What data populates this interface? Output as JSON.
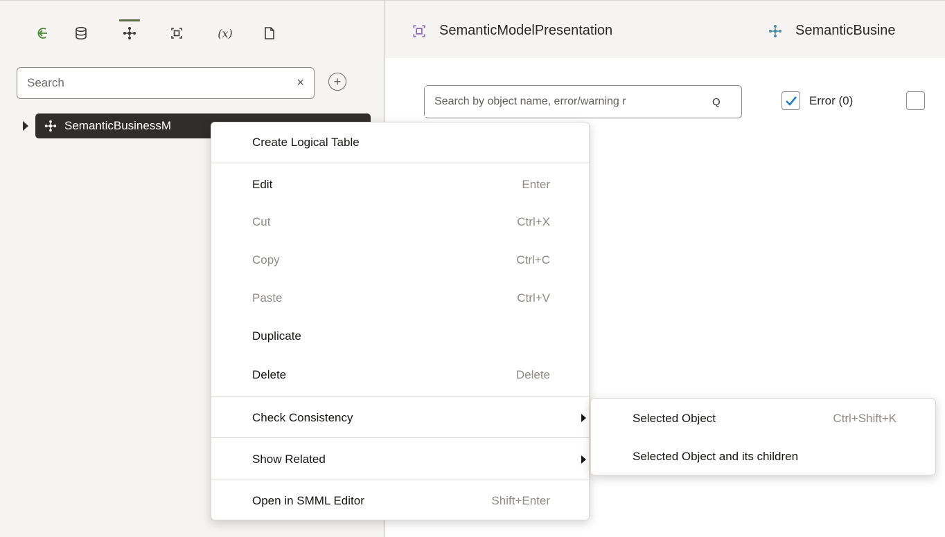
{
  "toolbar": {
    "icons": [
      "back-arrow-icon",
      "database-icon",
      "business-model-icon",
      "presentation-icon",
      "variables-icon",
      "document-icon"
    ],
    "variables_label": "(x)",
    "active_index": 2
  },
  "search": {
    "placeholder": "Search",
    "clear_label": "×",
    "add_label": "+"
  },
  "tree": {
    "node_label": "SemanticBusinessM"
  },
  "tabs": [
    {
      "label": "SemanticModelPresentation",
      "icon": "presentation-icon"
    },
    {
      "label": "SemanticBusine",
      "icon": "business-model-icon"
    }
  ],
  "issues": {
    "search_placeholder": "Search by object name, error/warning r",
    "search_icon": "Q",
    "error_label": "Error (0)",
    "error_checked": true,
    "warning_checked": false
  },
  "context_menu": {
    "items": [
      {
        "label": "Create Logical Table",
        "shortcut": "",
        "disabled": false
      },
      {
        "label": "Edit",
        "shortcut": "Enter",
        "disabled": false
      },
      {
        "label": "Cut",
        "shortcut": "Ctrl+X",
        "disabled": true
      },
      {
        "label": "Copy",
        "shortcut": "Ctrl+C",
        "disabled": true
      },
      {
        "label": "Paste",
        "shortcut": "Ctrl+V",
        "disabled": true
      },
      {
        "label": "Duplicate",
        "shortcut": "",
        "disabled": false
      },
      {
        "label": "Delete",
        "shortcut": "Delete",
        "disabled": false
      },
      {
        "label": "Check Consistency",
        "shortcut": "",
        "disabled": false,
        "submenu": true
      },
      {
        "label": "Show Related",
        "shortcut": "",
        "disabled": false,
        "submenu": true
      },
      {
        "label": "Open in SMML Editor",
        "shortcut": "Shift+Enter",
        "disabled": false
      }
    ]
  },
  "submenu": {
    "items": [
      {
        "label": "Selected Object",
        "shortcut": "Ctrl+Shift+K"
      },
      {
        "label": "Selected Object and its children",
        "shortcut": ""
      }
    ]
  },
  "colors": {
    "accent_green": "#5a6b46",
    "selected_node_bg": "#312d2a",
    "checkbox_blue": "#227ec9",
    "presentation_icon": "#8a6fb0",
    "business_icon": "#4f8a9c"
  }
}
